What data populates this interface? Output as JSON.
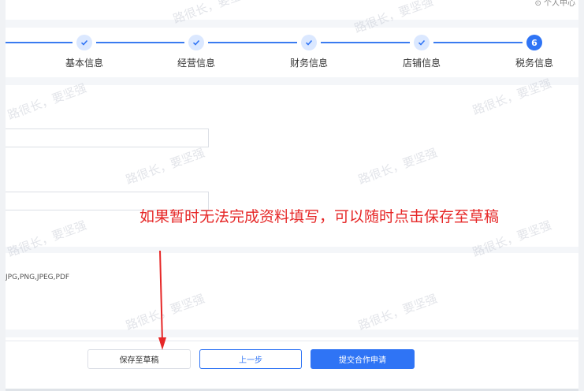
{
  "topbar": {
    "text": "⊙ 个人中心"
  },
  "steps": [
    {
      "label": "基本信息",
      "state": "done",
      "icon": "check-icon"
    },
    {
      "label": "经营信息",
      "state": "done",
      "icon": "check-icon"
    },
    {
      "label": "财务信息",
      "state": "done",
      "icon": "check-icon"
    },
    {
      "label": "店铺信息",
      "state": "done",
      "icon": "check-icon"
    },
    {
      "label": "税务信息",
      "state": "current",
      "number": "6"
    }
  ],
  "upload": {
    "hint": "JPG,PNG,JPEG,PDF"
  },
  "annotation": {
    "text": "如果暂时无法完成资料填写，可以随时点击保存至草稿"
  },
  "buttons": {
    "save_draft": "保存至草稿",
    "previous": "上一步",
    "submit": "提交合作申请"
  },
  "watermark": {
    "text": "路很长，要坚强"
  },
  "colors": {
    "primary": "#2f74f5",
    "annotation": "#e62727"
  }
}
